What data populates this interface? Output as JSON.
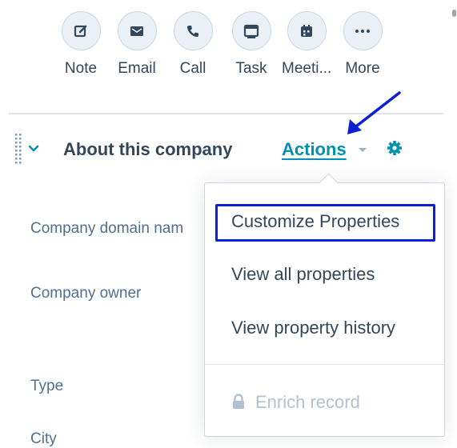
{
  "activity_bar": {
    "items": [
      {
        "label": "Note",
        "icon": "note-edit-icon"
      },
      {
        "label": "Email",
        "icon": "email-icon"
      },
      {
        "label": "Call",
        "icon": "phone-icon"
      },
      {
        "label": "Task",
        "icon": "task-icon"
      },
      {
        "label": "Meeti...",
        "icon": "calendar-icon"
      },
      {
        "label": "More",
        "icon": "more-dots-icon"
      }
    ]
  },
  "section": {
    "title": "About this company",
    "actions_label": "Actions"
  },
  "properties": {
    "labels": [
      "Company domain nam",
      "Company owner",
      "Type",
      "City"
    ]
  },
  "actions_menu": {
    "items": [
      "Customize Properties",
      "View all properties",
      "View property history"
    ],
    "highlighted": "Customize Properties",
    "disabled_item": "Enrich record"
  },
  "colors": {
    "accent": "#0091ae",
    "text": "#33475b",
    "muted": "#516f90",
    "annotation": "#0a1fd6",
    "disabled": "#b0c1d4"
  }
}
